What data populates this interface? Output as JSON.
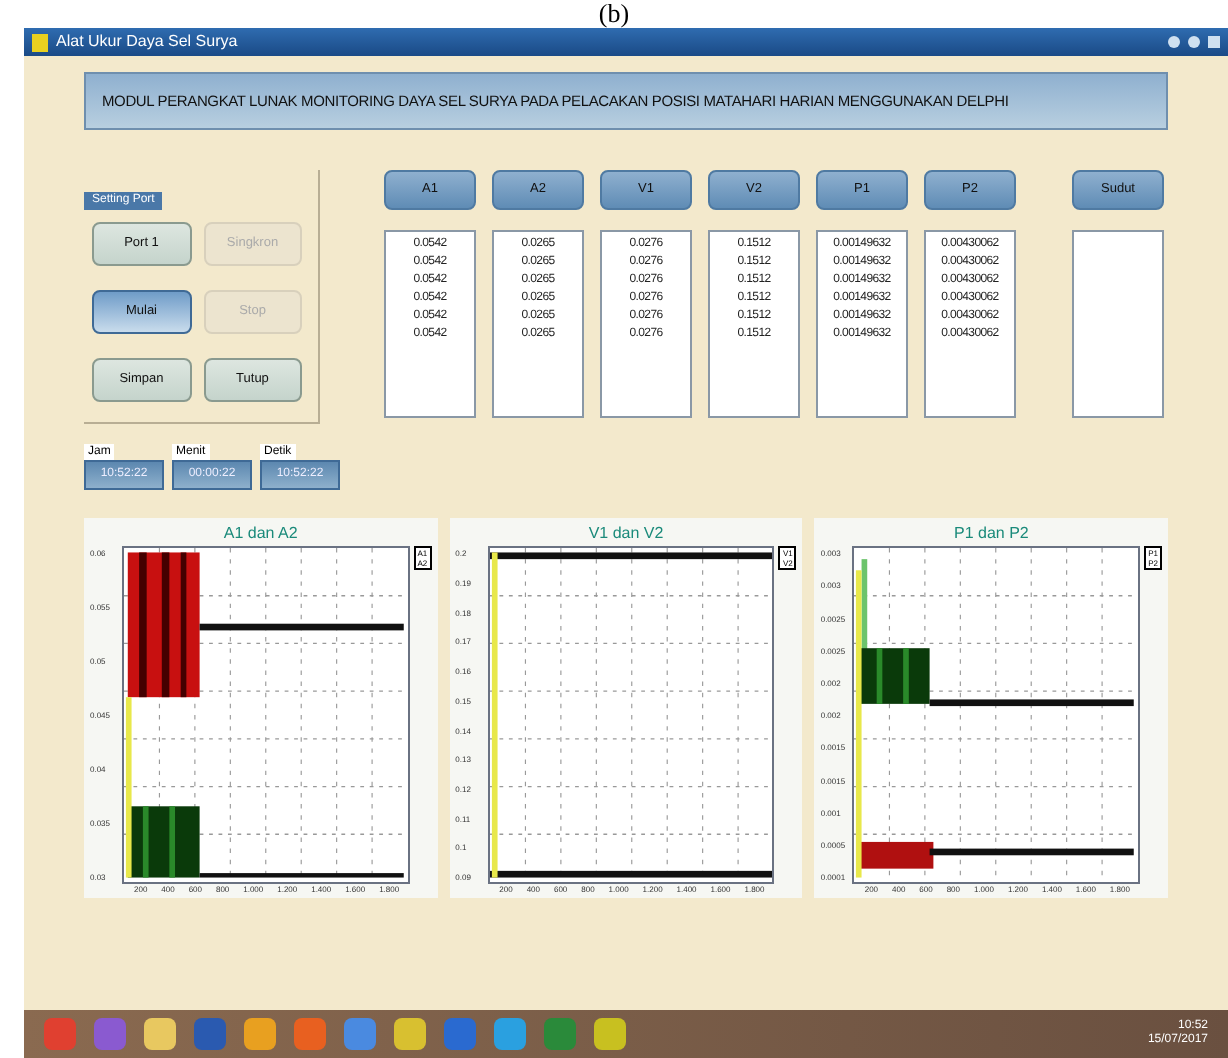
{
  "caption": "(b)",
  "window": {
    "title": "Alat Ukur Daya Sel Surya"
  },
  "header": "MODUL PERANGKAT LUNAK MONITORING DAYA SEL SURYA PADA PELACAKAN POSISI MATAHARI HARIAN MENGGUNAKAN DELPHI",
  "settings": {
    "title": "Setting Port",
    "buttons": [
      {
        "label": "Port 1",
        "disabled": false,
        "selected": false
      },
      {
        "label": "Singkron",
        "disabled": true,
        "selected": false
      },
      {
        "label": "Mulai",
        "disabled": false,
        "selected": true
      },
      {
        "label": "Stop",
        "disabled": true,
        "selected": false
      },
      {
        "label": "Simpan",
        "disabled": false,
        "selected": false
      },
      {
        "label": "Tutup",
        "disabled": false,
        "selected": false
      }
    ]
  },
  "clocks": [
    {
      "label": "Jam",
      "value": "10:52:22"
    },
    {
      "label": "Menit",
      "value": "00:00:22"
    },
    {
      "label": "Detik",
      "value": "10:52:22"
    }
  ],
  "columns": [
    {
      "header": "A1",
      "values": [
        "0.0542",
        "0.0542",
        "0.0542",
        "0.0542",
        "0.0542",
        "0.0542"
      ]
    },
    {
      "header": "A2",
      "values": [
        "0.0265",
        "0.0265",
        "0.0265",
        "0.0265",
        "0.0265",
        "0.0265"
      ]
    },
    {
      "header": "V1",
      "values": [
        "0.0276",
        "0.0276",
        "0.0276",
        "0.0276",
        "0.0276",
        "0.0276"
      ]
    },
    {
      "header": "V2",
      "values": [
        "0.1512",
        "0.1512",
        "0.1512",
        "0.1512",
        "0.1512",
        "0.1512"
      ]
    },
    {
      "header": "P1",
      "values": [
        "0.00149632",
        "0.00149632",
        "0.00149632",
        "0.00149632",
        "0.00149632",
        "0.00149632"
      ]
    },
    {
      "header": "P2",
      "values": [
        "0.00430062",
        "0.00430062",
        "0.00430062",
        "0.00430062",
        "0.00430062",
        "0.00430062"
      ]
    },
    {
      "header": "Sudut"
    }
  ],
  "charts": [
    {
      "title": "A1 dan A2",
      "kind": "current",
      "legend": [
        "A1",
        "A2"
      ],
      "yticks": [
        "0.06",
        "0.055",
        "0.05",
        "0.045",
        "0.04",
        "0.035",
        "0.03"
      ],
      "xticks": [
        "200",
        "400",
        "600",
        "800",
        "1.000",
        "1.200",
        "1.400",
        "1.600",
        "1.800"
      ]
    },
    {
      "title": "V1 dan V2",
      "kind": "voltage",
      "legend": [
        "V1",
        "V2"
      ],
      "yticks": [
        "0.2",
        "0.19",
        "0.18",
        "0.17",
        "0.16",
        "0.15",
        "0.14",
        "0.13",
        "0.12",
        "0.11",
        "0.1",
        "0.09"
      ],
      "xticks": [
        "200",
        "400",
        "600",
        "800",
        "1.000",
        "1.200",
        "1.400",
        "1.600",
        "1.800"
      ]
    },
    {
      "title": "P1 dan P2",
      "kind": "power",
      "legend": [
        "P1",
        "P2"
      ],
      "yticks": [
        "0.003",
        "0.003",
        "0.0025",
        "0.0025",
        "0.002",
        "0.002",
        "0.0015",
        "0.0015",
        "0.001",
        "0.0005",
        "0.0001"
      ],
      "xticks": [
        "200",
        "400",
        "600",
        "800",
        "1.000",
        "1.200",
        "1.400",
        "1.600",
        "1.800"
      ]
    }
  ],
  "taskbar": {
    "time": "10:52",
    "date": "15/07/2017"
  }
}
